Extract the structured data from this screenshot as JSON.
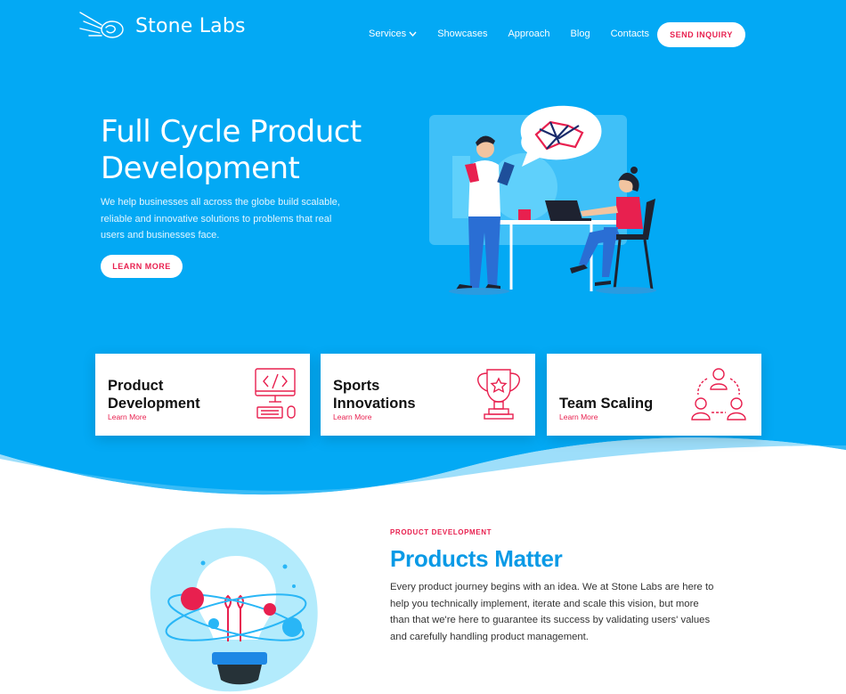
{
  "brand": {
    "name": "Stone Labs"
  },
  "nav": {
    "items": [
      "Services",
      "Showcases",
      "Approach",
      "Blog",
      "Contacts"
    ],
    "cta": "SEND INQUIRY"
  },
  "hero": {
    "title": "Full Cycle Product Development",
    "description": "We help businesses all across the globe build scalable, reliable and innovative solutions to problems that real users and businesses face.",
    "button": "LEARN MORE"
  },
  "cards": [
    {
      "title": "Product Development",
      "link": "Learn More",
      "icon": "computer-code-icon"
    },
    {
      "title": "Sports Innovations",
      "link": "Learn More",
      "icon": "trophy-icon"
    },
    {
      "title": "Team Scaling",
      "link": "Learn More",
      "icon": "team-network-icon"
    }
  ],
  "section": {
    "tag": "PRODUCT DEVELOPMENT",
    "title": "Products Matter",
    "text": "Every product journey begins with an idea. We at Stone Labs are here to help you technically implement, iterate and scale this vision, but more than that we're here to guarantee its success by validating users' values and carefully handling product management."
  },
  "colors": {
    "primary": "#03a9f4",
    "accent": "#e8204f",
    "title_blue": "#0a9ae6"
  }
}
